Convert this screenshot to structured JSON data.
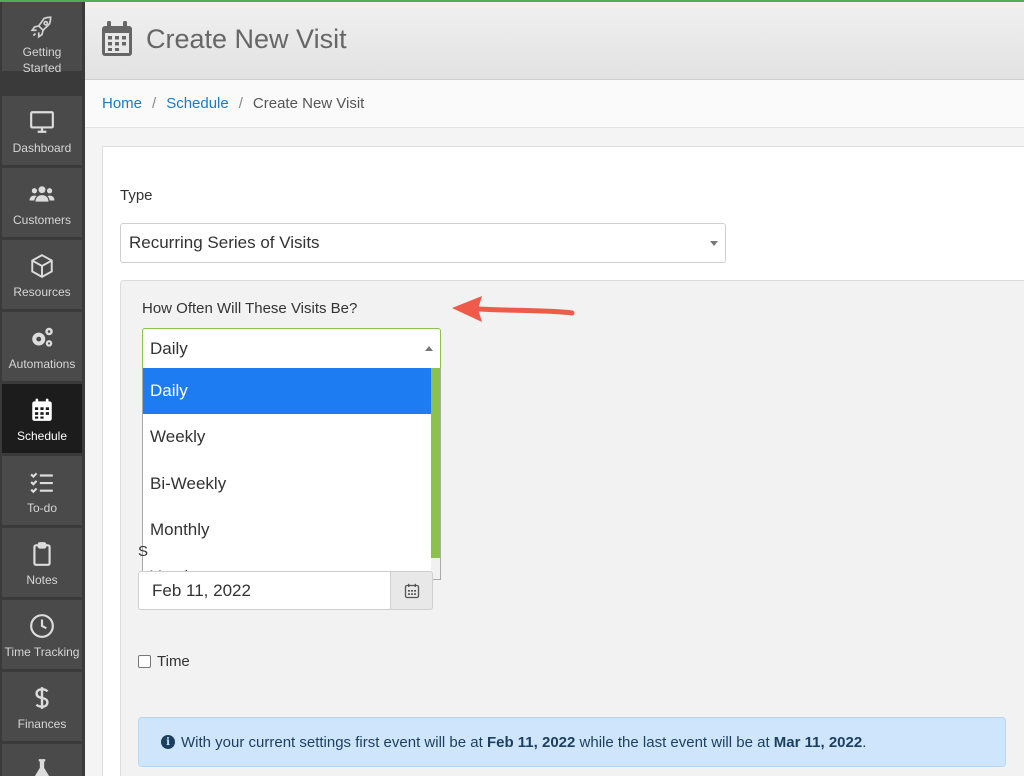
{
  "sidebar": {
    "items": [
      {
        "label": "Getting Started",
        "icon": "rocket-icon"
      },
      {
        "label": "Dashboard",
        "icon": "monitor-icon"
      },
      {
        "label": "Customers",
        "icon": "users-icon"
      },
      {
        "label": "Resources",
        "icon": "cube-icon"
      },
      {
        "label": "Automations",
        "icon": "gears-icon"
      },
      {
        "label": "Schedule",
        "icon": "calendar-icon",
        "active": true
      },
      {
        "label": "To-do",
        "icon": "checklist-icon"
      },
      {
        "label": "Notes",
        "icon": "clipboard-icon"
      },
      {
        "label": "Time Tracking",
        "icon": "clock-icon"
      },
      {
        "label": "Finances",
        "icon": "dollar-icon"
      },
      {
        "label": "",
        "icon": "flask-icon"
      }
    ]
  },
  "header": {
    "title": "Create New Visit",
    "icon": "calendar-icon"
  },
  "breadcrumb": {
    "home": "Home",
    "sep": "/",
    "schedule": "Schedule",
    "current": "Create New Visit"
  },
  "form": {
    "type_label": "Type",
    "type_value": "Recurring Series of Visits",
    "freq_label": "How Often Will These Visits Be?",
    "freq_value": "Daily",
    "freq_options": [
      "Daily",
      "Weekly",
      "Bi-Weekly",
      "Monthly",
      "Yearly"
    ],
    "start_peek": "S",
    "start_date": "Feb 11, 2022",
    "time_label": "Time",
    "info": {
      "prefix": "With your current settings first event will be at ",
      "first": "Feb 11, 2022",
      "middle": " while the last event will be at ",
      "last": "Mar 11, 2022",
      "suffix": "."
    }
  },
  "colors": {
    "accent": "#1e7cf2",
    "link": "#1a7bc7",
    "focus": "#8bc34a",
    "arrow": "#ef5a4a",
    "info_bg": "#cfe5fb"
  }
}
